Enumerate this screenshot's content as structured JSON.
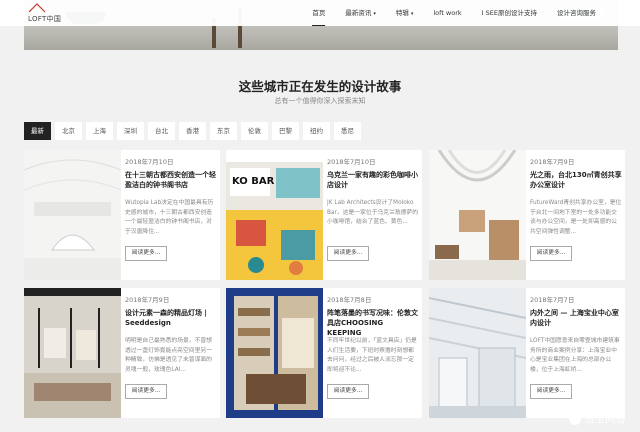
{
  "header": {
    "logo_text": "LOFT中国",
    "nav": [
      {
        "label": "首页",
        "active": true,
        "caret": false
      },
      {
        "label": "最新资讯",
        "active": false,
        "caret": true
      },
      {
        "label": "特辑",
        "active": false,
        "caret": true
      },
      {
        "label": "loft work",
        "active": false,
        "caret": false
      },
      {
        "label": "I SEE原创设计支持",
        "active": false,
        "caret": false
      },
      {
        "label": "设计咨询服务",
        "active": false,
        "caret": false
      }
    ]
  },
  "section": {
    "title": "这些城市正在发生的设计故事",
    "subtitle": "总有一个值得你深入探索末知"
  },
  "tabs": [
    "最新",
    "北京",
    "上海",
    "深圳",
    "台北",
    "香港",
    "东京",
    "伦敦",
    "巴黎",
    "纽约",
    "悉尼"
  ],
  "cards": [
    {
      "date": "2018年7月10日",
      "title": "在十三朝古都西安创造一个轻盈洁白的钟书阁书店",
      "excerpt": "Wutopia Lab决定在中国最具有历史感的城市，十三朝古都西安创造一个最轻盈洁白的钟书阁书店，对于汉唐降住...",
      "more": "阅读更多..."
    },
    {
      "date": "2018年7月10日",
      "title": "乌克兰一家有趣的彩色咖啡小店设计",
      "excerpt": "JK Lab Architects设计了Moloko Bar，这是一家位于乌克兰敖德萨的小咖啡馆，结合了蓝色、黄色...",
      "more": "阅读更多..."
    },
    {
      "date": "2018年7月9日",
      "title": "光之雨，台北130㎡青创共享办公室设计",
      "excerpt": "FutureWard青创共享办公室，是位于台北一间地下室的一处多功能交谈与办公空间，是一处抑高感的公共空间弹性调整...",
      "more": "阅读更多..."
    },
    {
      "date": "2018年7月9日",
      "title": "设计元素一森的精品灯场 | Seeddesign",
      "excerpt": "明明是自己最熟悉的场景，不曾想透过一盏灯饰竟能点亮空间里另一种精致，仿佛是透见了未曾谋面的灵魂一般，玫瑰色LAI...",
      "more": "阅读更多..."
    },
    {
      "date": "2018年7月8日",
      "title": "阵笔落墨的书写况味：伦敦文具店CHOOSING KEEPING",
      "excerpt": "不同牢世纪以前，「蓝文具店」仍是人们生活要，下班时察撸时刻想都去问问，经过之后被人淡忘那一定即将迎不论...",
      "more": "阅读更多..."
    },
    {
      "date": "2018年7月7日",
      "title": "内外之间 — 上海宝业中心室内设计",
      "excerpt": "LOFT中国愿意来自零壹城市建筑事务所的商业案例分享：上海宝业中心是宝业集团在上海的总部办公楼，位于上海虹桥...",
      "more": "阅读更多..."
    }
  ],
  "watermark": "悟空问答"
}
